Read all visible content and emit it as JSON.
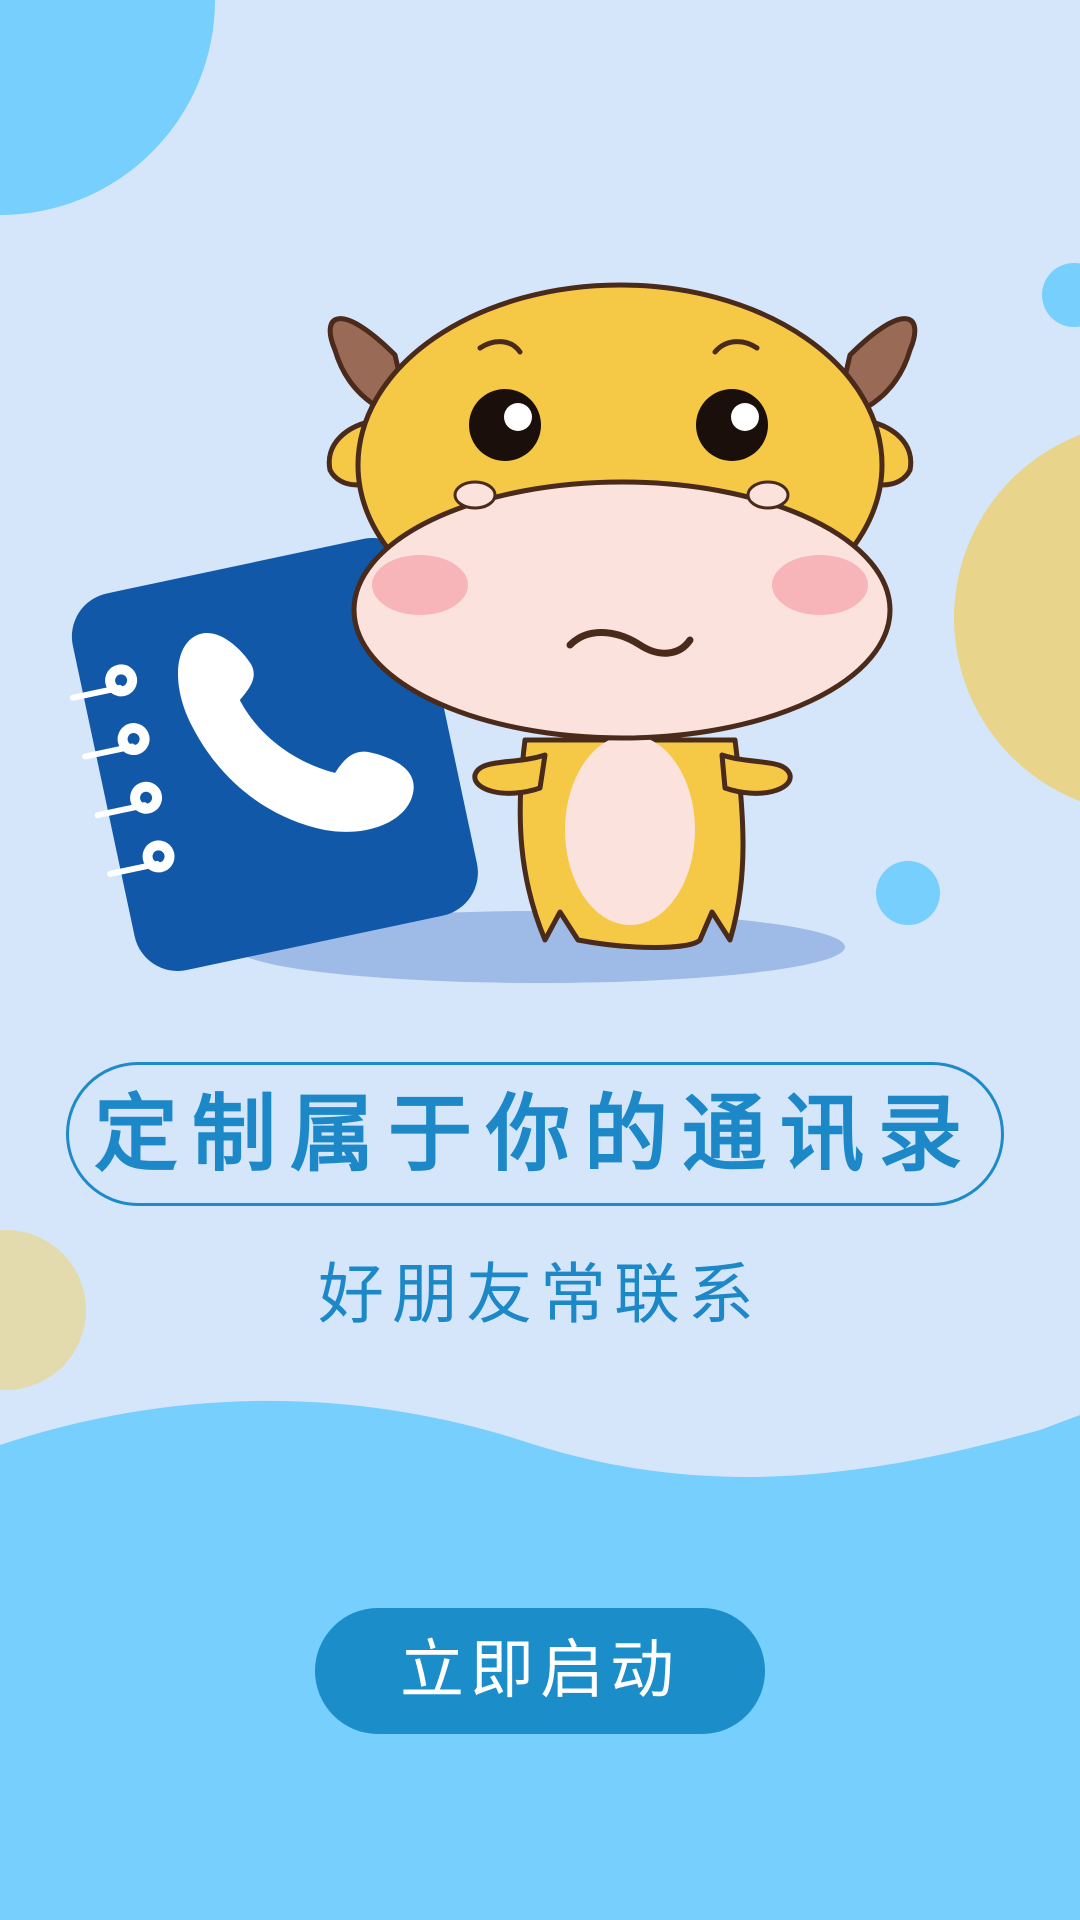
{
  "colors": {
    "background": "#d5e6fb",
    "accent_light_blue": "#76cffd",
    "accent_sand": "#e8d48a",
    "primary_blue": "#1b8dc9",
    "book_blue": "#1158a9",
    "mascot_yellow": "#f5c845"
  },
  "illustration": {
    "mascot": "cartoon-yellow-bull-mascot",
    "object": "phone-contact-book",
    "icon": "phone-handset-icon"
  },
  "headline": {
    "text": "定制属于你的通讯录"
  },
  "subheadline": {
    "text": "好朋友常联系"
  },
  "start_button": {
    "label": "立即启动"
  }
}
